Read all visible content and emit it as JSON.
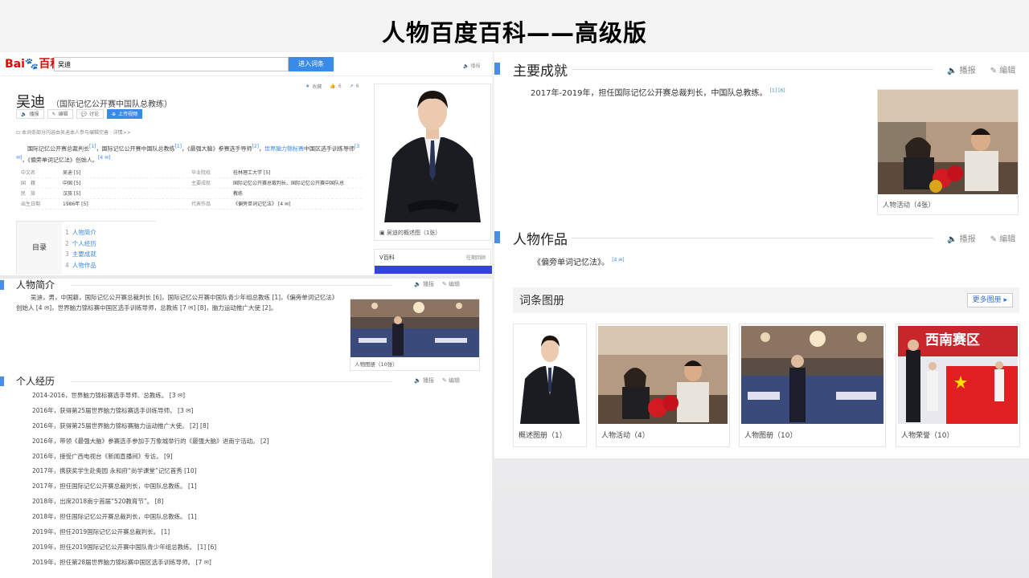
{
  "slide_title": "人物百度百科——高级版",
  "left": {
    "logo": {
      "part1": "Bai",
      "part2": "百科"
    },
    "search": {
      "value": "吴迪",
      "button": "进入词条"
    },
    "header_action": "播报",
    "stats": {
      "favorite": "收藏",
      "likes": "6",
      "shares": "6"
    },
    "name": "吴迪",
    "subtitle": "（国际记忆公开赛中国队总教练）",
    "actions": [
      "播报",
      "编辑",
      "讨论",
      "上传视频"
    ],
    "notice": "本词条部分内容由吴迪本人参与编辑完善 · 详情>>",
    "summary_html_parts": {
      "p1": "国际记忆公开赛总裁判长",
      "r1": "[1]",
      "p2": "，国际记忆公开赛中国队总教练",
      "r2": "[1]",
      "p3": "，《最强大脑》参赛选手导师",
      "r3": "[2]",
      "p4": "，",
      "link": "世界脑力锦标赛",
      "p5": "中国区选手训练导师",
      "r4": "[3 ✉]",
      "p6": "，《偏旁单词记忆法》创始人。",
      "r5": "[4 ✉]"
    },
    "basic_info": [
      {
        "k1": "中文名",
        "v1": "吴迪 [5]",
        "k2": "毕业院校",
        "v2": "桂林理工大学 [5]"
      },
      {
        "k1": "国　籍",
        "v1": "中国 [5]",
        "k2": "主要成就",
        "v2": "国际记忆公开赛总裁判长、国际记忆公开赛中国队总"
      },
      {
        "k1": "民　族",
        "v1": "汉族 [5]",
        "k2": "",
        "v2": "教练"
      },
      {
        "k1": "出生日期",
        "v1": "1986年 [5]",
        "k2": "代表作品",
        "v2": "《偏旁单词记忆法》 [4 ✉]"
      }
    ],
    "catalog": {
      "label": "目录",
      "items": [
        {
          "n": "1",
          "t": "人物简介"
        },
        {
          "n": "2",
          "t": "个人经历"
        },
        {
          "n": "3",
          "t": "主要成就"
        },
        {
          "n": "4",
          "t": "人物作品"
        }
      ]
    },
    "portrait_caption": "吴迪的概述图（1张）",
    "vbaike": {
      "title": "V百科",
      "right": "往期回顾"
    },
    "bio": {
      "title": "人物简介",
      "ops": [
        "播报",
        "编辑"
      ],
      "text": "吴迪，男，中国籍，国际记忆公开赛总裁判长 [6]，国际记忆公开赛中国队青少年组总教练 [1]，《偏旁单词记忆法》创始人 [4 ✉]，世界脑力锦标赛中国区选手训练导师，总教练 [7 ✉] [8]，脑力运动推广大使 [2]。",
      "photo_caption": "人物图册（10张）"
    },
    "career": {
      "title": "个人经历",
      "ops": [
        "播报",
        "编辑"
      ],
      "items": [
        "2014-2016，世界脑力锦标赛选手导师、总教练。 [3 ✉]",
        "2016年，获得第25届世界脑力锦标赛选手训练导师。 [3 ✉]",
        "2016年，获得第25届世界脑力锦标赛脑力运动推广大使。 [2] [8]",
        "2016年，带领《最强大脑》参赛选手参加于万象城举行的《最强大脑》进南宁活动。 [2]",
        "2016年，接受广西电视台《新闻直播间》专访。 [9]",
        "2017年，携获奖学生赴奥园 永和府“尚学课堂”记忆首秀 [10]",
        "2017年，担任国际记忆公开赛总裁判长，中国队总教练。 [1]",
        "2018年，出席2018南宁首届“520教育节”。 [8]",
        "2018年，担任国际记忆公开赛总裁判长，中国队总教练。 [1]",
        "2019年，担任2019国际记忆公开赛总裁判长。 [1]",
        "2019年，担任2019国际记忆公开赛中国队青少年组总教练。 [1] [6]",
        "2019年，担任第28届世界脑力锦标赛中国区选手训练导师。 [7 ✉]"
      ]
    }
  },
  "right": {
    "achievements": {
      "title": "主要成就",
      "ops": [
        "播报",
        "编辑"
      ],
      "text": "2017年-2019年，担任国际记忆公开赛总裁判长，中国队总教练。",
      "refs": "[1] [6]",
      "photo_caption": "人物活动（4张）"
    },
    "works": {
      "title": "人物作品",
      "ops": [
        "播报",
        "编辑"
      ],
      "text": "《偏旁单词记忆法》。",
      "refs": "[4 ✉]"
    },
    "albums": {
      "title": "词条图册",
      "more": "更多图册 ▸",
      "items": [
        {
          "caption": "概述图册（1）"
        },
        {
          "caption": "人物活动（4）"
        },
        {
          "caption": "人物图册（10）"
        },
        {
          "caption": "人物荣誉（10）",
          "banner": "西南赛区"
        }
      ]
    }
  }
}
